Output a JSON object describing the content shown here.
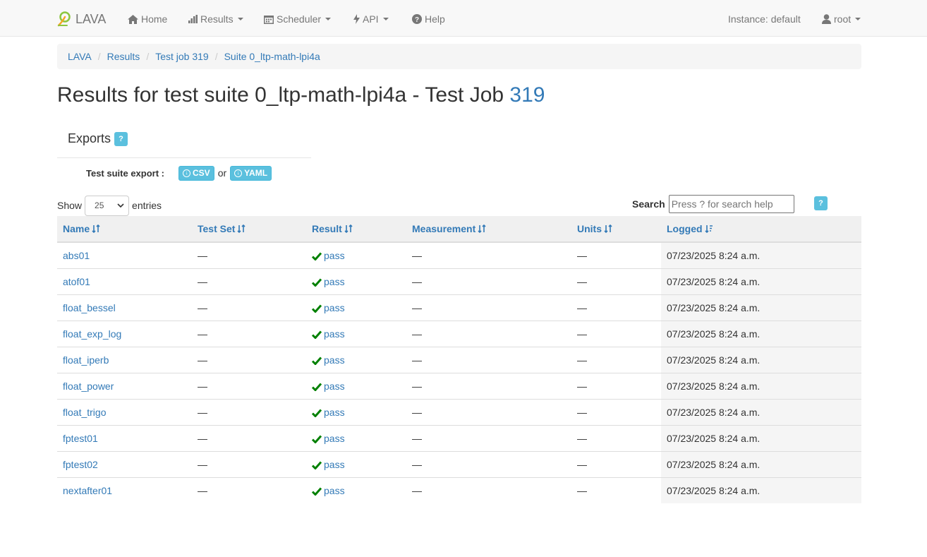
{
  "navbar": {
    "brand": "LAVA",
    "home": "Home",
    "results": "Results",
    "scheduler": "Scheduler",
    "api": "API",
    "help": "Help",
    "instance": "Instance: default",
    "user": "root"
  },
  "breadcrumb": [
    "LAVA",
    "Results",
    "Test job 319",
    "Suite 0_ltp-math-lpi4a"
  ],
  "title": {
    "prefix": "Results for test suite 0_ltp-math-lpi4a - Test Job ",
    "job_id": "319"
  },
  "exports": {
    "heading": "Exports",
    "help": "?",
    "suite_export_label": "Test suite export :",
    "csv": "CSV",
    "or": "or",
    "yaml": "YAML"
  },
  "table_controls": {
    "show_label": "Show",
    "entries_value": "25",
    "entries_label": "entries",
    "search_label": "Search",
    "search_placeholder": "Press ? for search help",
    "help": "?"
  },
  "table": {
    "headers": [
      "Name",
      "Test Set",
      "Result",
      "Measurement",
      "Units",
      "Logged"
    ],
    "rows": [
      {
        "name": "abs01",
        "test_set": "—",
        "result": "pass",
        "measurement": "—",
        "units": "—",
        "logged": "07/23/2025 8:24 a.m."
      },
      {
        "name": "atof01",
        "test_set": "—",
        "result": "pass",
        "measurement": "—",
        "units": "—",
        "logged": "07/23/2025 8:24 a.m."
      },
      {
        "name": "float_bessel",
        "test_set": "—",
        "result": "pass",
        "measurement": "—",
        "units": "—",
        "logged": "07/23/2025 8:24 a.m."
      },
      {
        "name": "float_exp_log",
        "test_set": "—",
        "result": "pass",
        "measurement": "—",
        "units": "—",
        "logged": "07/23/2025 8:24 a.m."
      },
      {
        "name": "float_iperb",
        "test_set": "—",
        "result": "pass",
        "measurement": "—",
        "units": "—",
        "logged": "07/23/2025 8:24 a.m."
      },
      {
        "name": "float_power",
        "test_set": "—",
        "result": "pass",
        "measurement": "—",
        "units": "—",
        "logged": "07/23/2025 8:24 a.m."
      },
      {
        "name": "float_trigo",
        "test_set": "—",
        "result": "pass",
        "measurement": "—",
        "units": "—",
        "logged": "07/23/2025 8:24 a.m."
      },
      {
        "name": "fptest01",
        "test_set": "—",
        "result": "pass",
        "measurement": "—",
        "units": "—",
        "logged": "07/23/2025 8:24 a.m."
      },
      {
        "name": "fptest02",
        "test_set": "—",
        "result": "pass",
        "measurement": "—",
        "units": "—",
        "logged": "07/23/2025 8:24 a.m."
      },
      {
        "name": "nextafter01",
        "test_set": "—",
        "result": "pass",
        "measurement": "—",
        "units": "—",
        "logged": "07/23/2025 8:24 a.m."
      }
    ]
  },
  "colors": {
    "link": "#337ab7",
    "info": "#5bc0de",
    "pass_check": "#008000",
    "navbar_bg": "#f8f8f8"
  },
  "icons": {
    "brand": "lava-logo-icon",
    "home": "home-icon",
    "results": "bar-chart-icon",
    "scheduler": "calendar-icon",
    "api": "flash-icon",
    "help": "question-circle-icon",
    "user": "user-icon",
    "result": "check-icon",
    "sort": "sort-icon",
    "download": "download-circle-icon"
  }
}
